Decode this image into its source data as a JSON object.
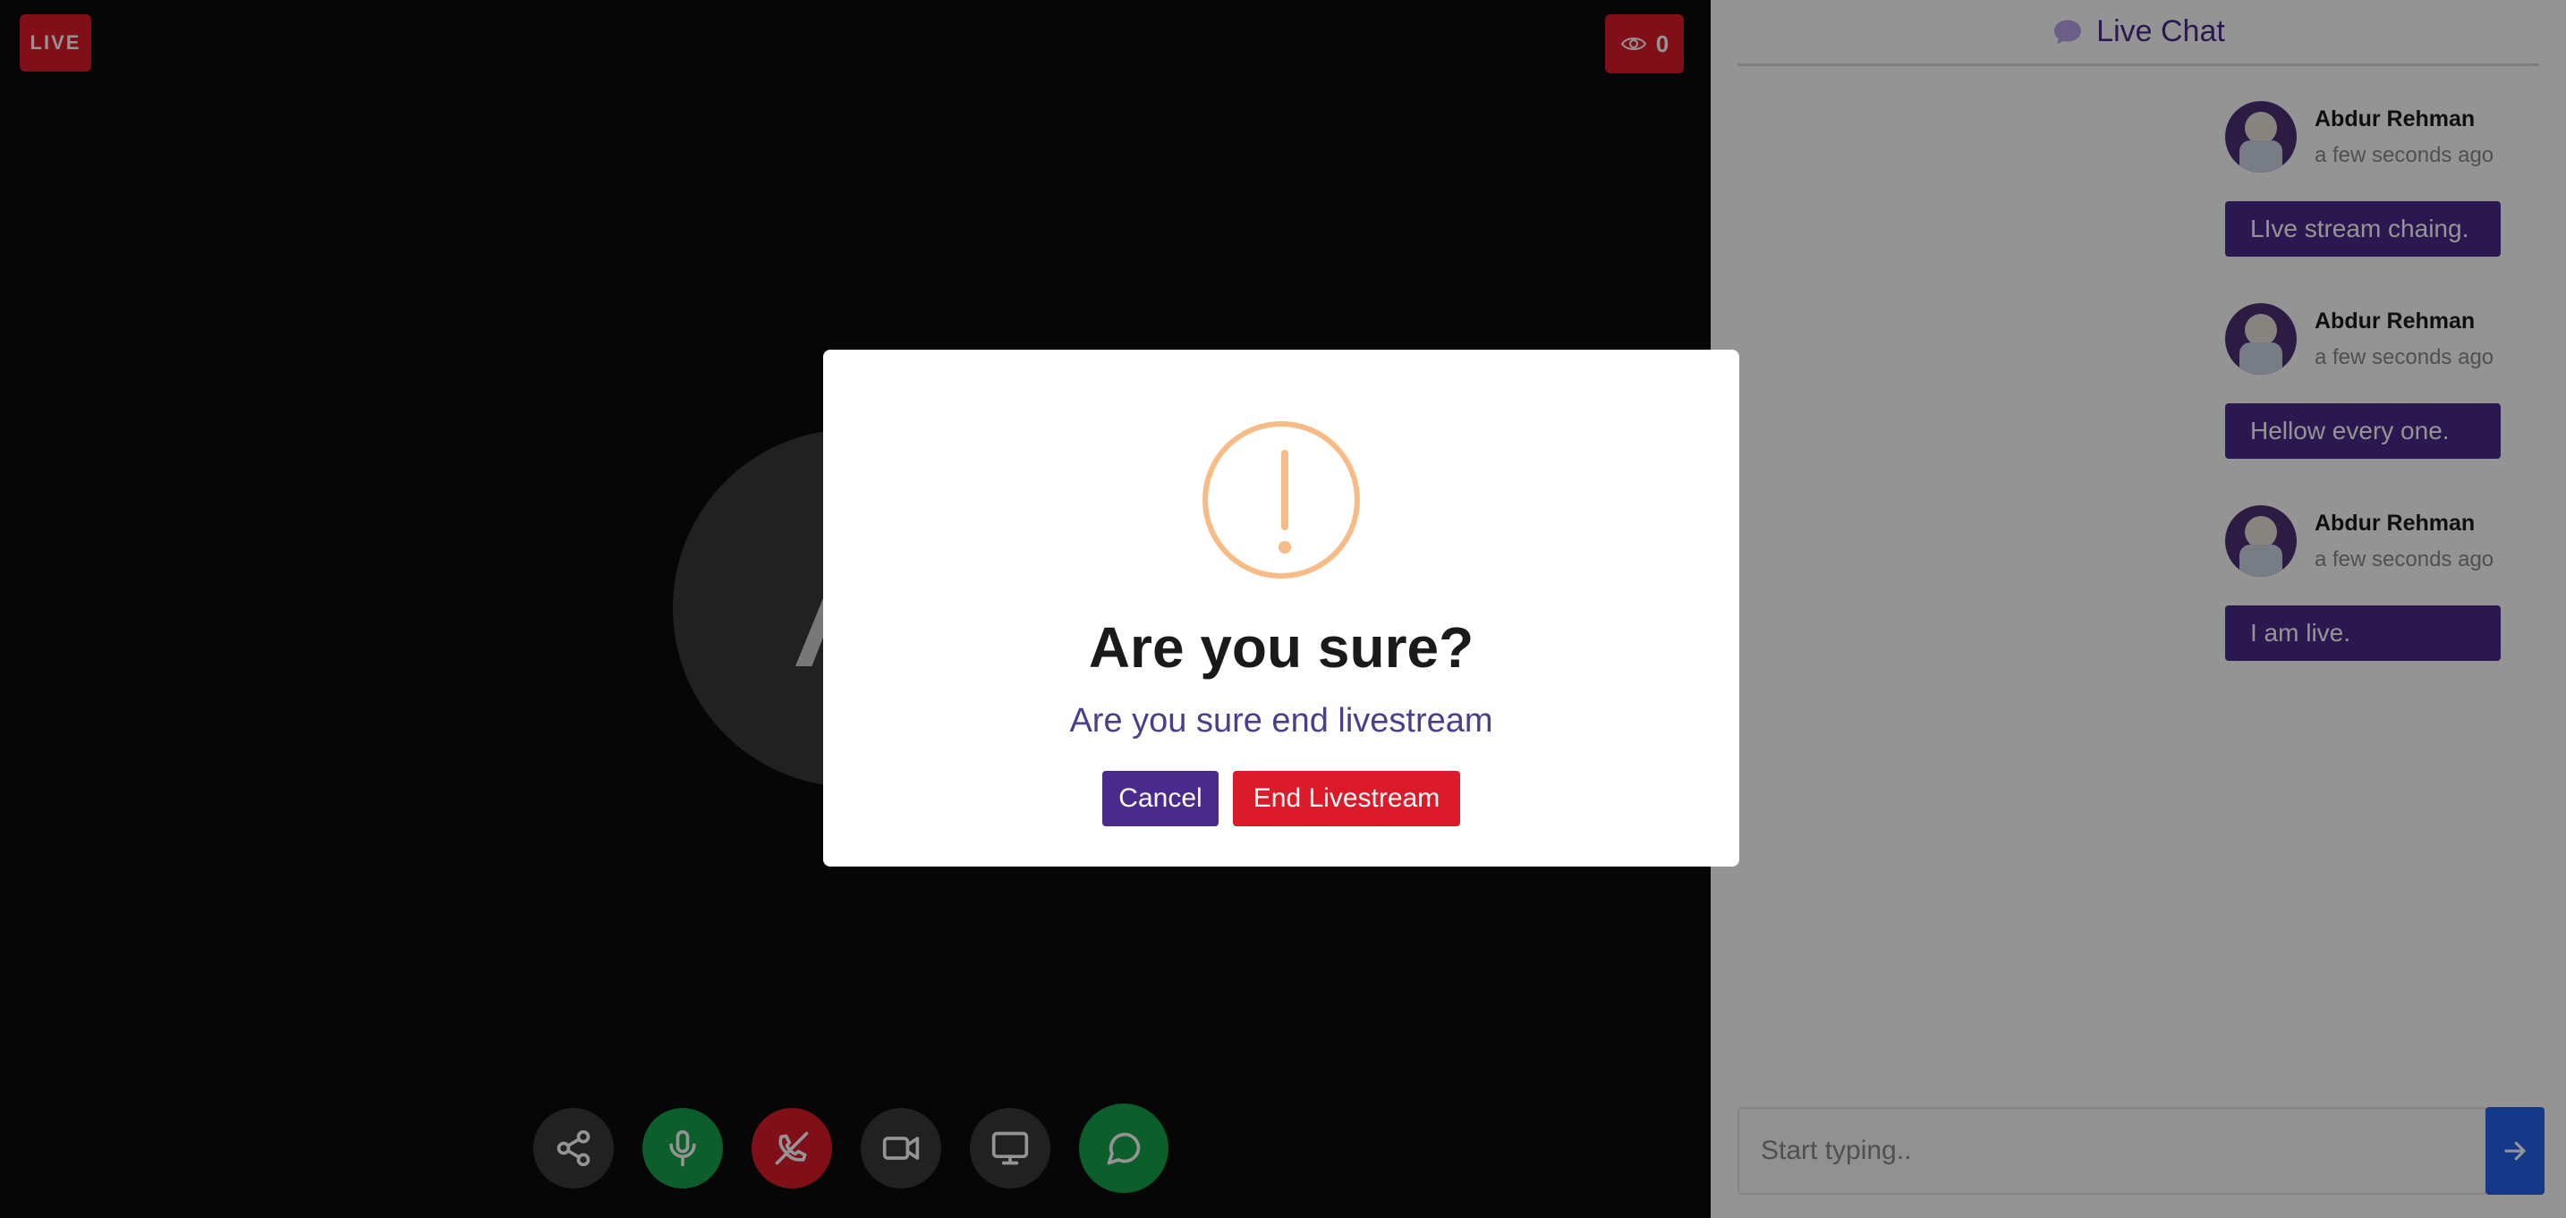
{
  "stage": {
    "live_label": "LIVE",
    "viewer_count": "0",
    "avatar_letter": "A"
  },
  "controls": [
    {
      "name": "share-button",
      "icon": "share-icon"
    },
    {
      "name": "microphone-button",
      "icon": "microphone-icon"
    },
    {
      "name": "end-call-button",
      "icon": "phone-off-icon"
    },
    {
      "name": "camera-button",
      "icon": "video-camera-icon"
    },
    {
      "name": "screen-share-button",
      "icon": "monitor-icon"
    },
    {
      "name": "chat-toggle-button",
      "icon": "chat-bubble-icon"
    }
  ],
  "chat": {
    "title": "Live Chat",
    "messages": [
      {
        "author": "Abdur Rehman",
        "time": "a few seconds ago",
        "text": "LIve stream chaing."
      },
      {
        "author": "Abdur Rehman",
        "time": "a few seconds ago",
        "text": "Hellow every one."
      },
      {
        "author": "Abdur Rehman",
        "time": "a few seconds ago",
        "text": "I am live."
      }
    ],
    "input_placeholder": "Start typing.."
  },
  "dialog": {
    "title": "Are you sure?",
    "text": "Are you sure end livestream",
    "cancel_label": "Cancel",
    "confirm_label": "End Livestream"
  },
  "colors": {
    "accent": "#4a2a8a",
    "danger": "#dc1b2a",
    "success": "#16a34a",
    "warning": "#f8bb86",
    "send": "#2563eb"
  }
}
